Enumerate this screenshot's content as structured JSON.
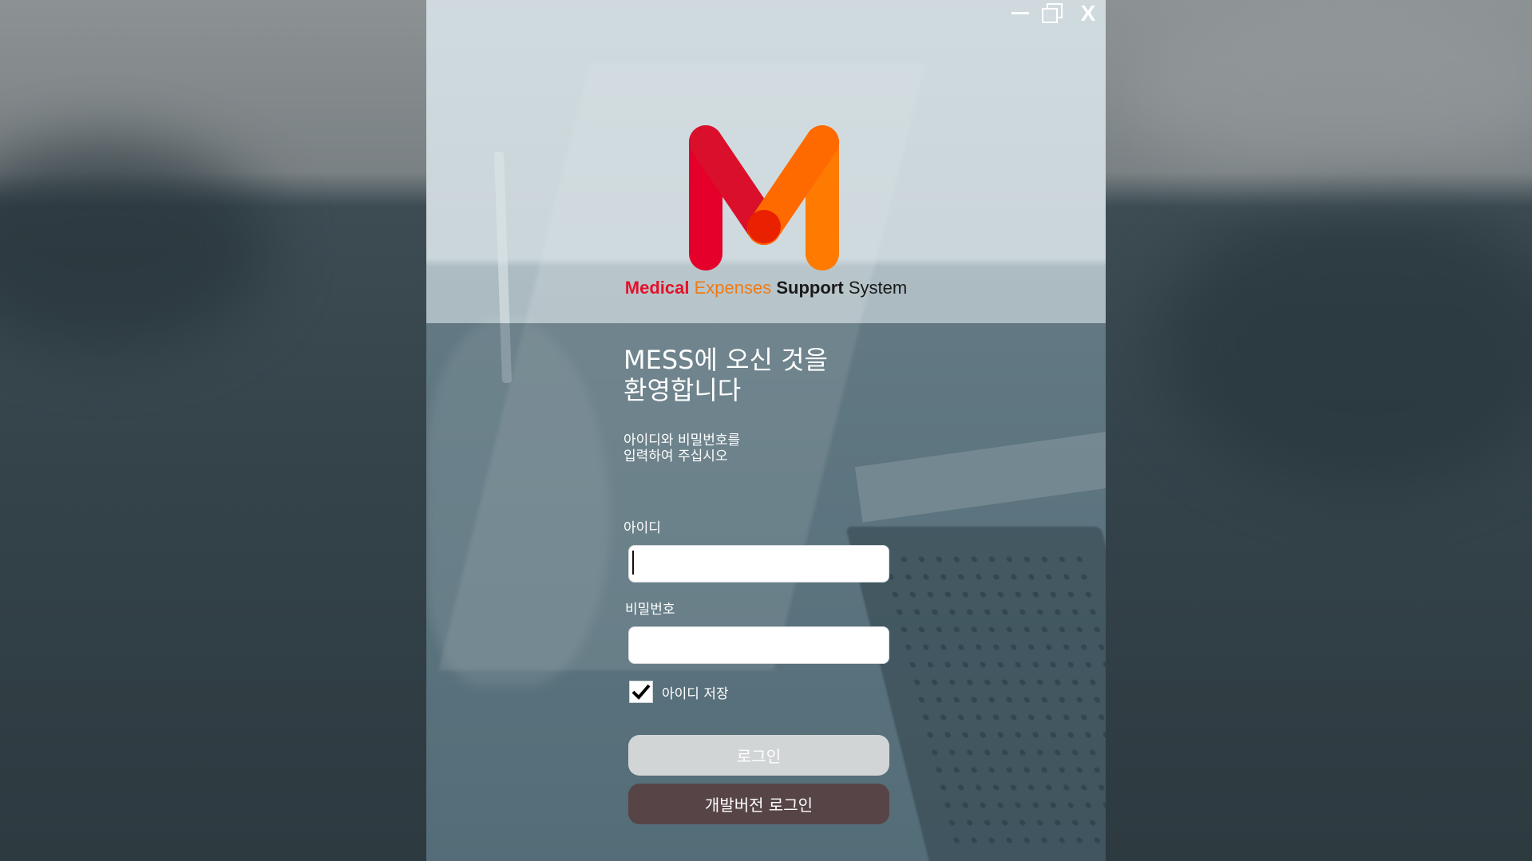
{
  "window": {
    "controls": {
      "minimize_icon": "minimize-icon",
      "restore_icon": "restore-icon",
      "close_label": "X"
    }
  },
  "brand": {
    "logo_letter": "M",
    "tagline": {
      "word1": "Medical",
      "word2": "Expenses",
      "word3": "Support",
      "word4": "System"
    },
    "colors": {
      "red": "#e3122b",
      "orange": "#f07b14",
      "dark": "#1a1a1a"
    }
  },
  "welcome": {
    "line1": "MESS에 오신 것을",
    "line2": "환영합니다"
  },
  "instruction": {
    "line1": "아이디와 비밀번호를",
    "line2": "입력하여 주십시오"
  },
  "form": {
    "id_label": "아이디",
    "id_value": "",
    "password_label": "비밀번호",
    "password_value": "",
    "remember_label": "아이디 저장",
    "remember_checked": true
  },
  "buttons": {
    "login": "로그인",
    "dev_login": "개발버전 로그인"
  }
}
